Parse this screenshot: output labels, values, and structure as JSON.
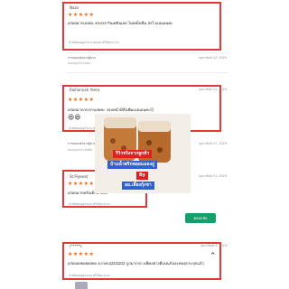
{
  "reviews": [
    {
      "name": "Naza",
      "date": "กุมภาพันธ์ 12, 2025",
      "stars": "★★★★★",
      "text": "อร่อยมากเลยค่ะ ครบรส กินเพลินเลย ไม่เหม็นหืน ส่งไวแน่นอนค่ะ",
      "helpful": "นำหยิบหน่อยู่จำนวน ทดลอง พรีเมียม สาแก",
      "reply_label": "การตอบกลับจากผู้ขาย",
      "reply_text": "ขอบคุณมากๆเลยค่ะ",
      "reply_date": "กุมภาพันธ์ 12, 2025"
    },
    {
      "name": "Raihannah Yeera",
      "date": "กุมภาพันธ์ 12, 2025",
      "stars": "★★★★★",
      "text": "อร่อยมากกกกกๆเลยค่ะ รอบหน้ามีสั่งเพิ่มแน่นอนค่ะ😊",
      "emoji": "😆😆",
      "helpful": "นำหยิบหน่อยู่จำนวน พรีเมียม สาแก",
      "reply_label": "การตอบกลับจากผู้ขาย",
      "reply_text": "ขอบคุณมากๆ ยินดีค่ะ",
      "reply_date": "กุมภาพันธ์ 12, 2025"
    },
    {
      "name": "St.Piyeeat",
      "date": "กุมภาพันธ์ 11, 2025",
      "stars": "★★★★★",
      "text": "อร่อยมากครับเด็กกำลังดี",
      "helpful": "นำหยิบหน่อยู่จำนวน พรีเมียม สาแก"
    },
    {
      "name": "r*****s",
      "date": "กุมภาพันธ์ 9, 2025",
      "stars": "★★★★★",
      "text": "อร่อยอยยยยยยยย มากค่ะzzzzzzzz ถูกมากกก แพ็คอย่างดีแน่นกันจะหมดกระปุกแล้ว",
      "helpful": "นำหยิบหน่อยู่จำนวน พรีเมียม สาแก"
    }
  ],
  "promo": {
    "line1": "รีวิวจริงจากลูกค้า",
    "line2": "บ้านน้ำพริกหอยแมลงภู่",
    "line3": "By",
    "line4": "อย.เลี้ยงกุ้งชา"
  },
  "buttons": {
    "reply_label": "ตอบกลับ"
  },
  "colors": {
    "highlight_border": "#e53935",
    "star": "#f06a1a",
    "promo_red": "#e02020",
    "promo_blue": "#2f5fd0",
    "button_green": "#14a06a"
  }
}
